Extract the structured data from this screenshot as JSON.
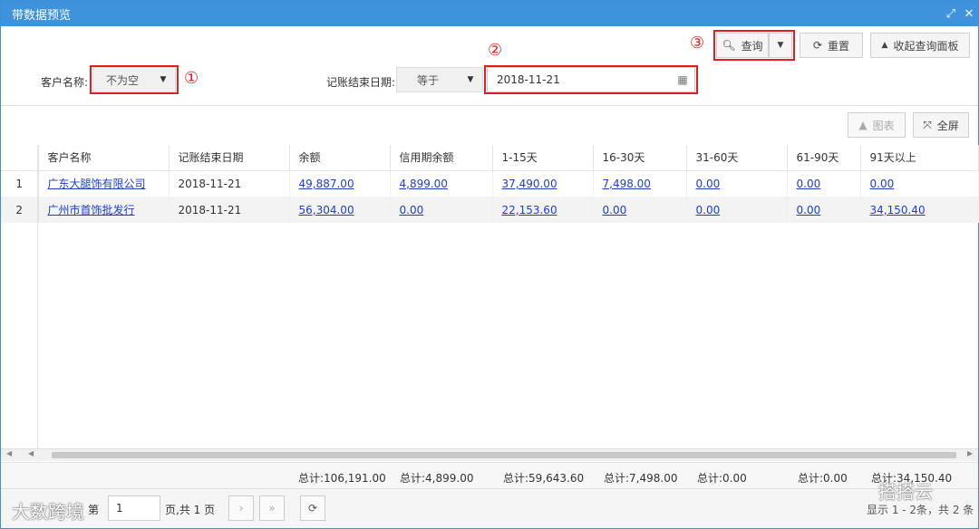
{
  "window": {
    "title": "带数据预览"
  },
  "toolbar": {
    "query_label": "查询",
    "reset_label": "重置",
    "collapse_label": "收起查询面板"
  },
  "filters": {
    "customer_label": "客户名称:",
    "customer_op": "不为空",
    "date_label": "记账结束日期:",
    "date_op": "等于",
    "date_value": "2018-11-21"
  },
  "annotations": [
    "①",
    "②",
    "③"
  ],
  "grid_toolbar": {
    "chart_label": "图表",
    "fullscreen_label": "全屏"
  },
  "table": {
    "columns": [
      "客户名称",
      "记账结束日期",
      "余额",
      "信用期余额",
      "1-15天",
      "16-30天",
      "31-60天",
      "61-90天",
      "91天以上"
    ],
    "rows": [
      {
        "num": "1",
        "customer": "广东大腿饰有限公司",
        "date": "2018-11-21",
        "balance": "49,887.00",
        "credit": "4,899.00",
        "d1_15": "37,490.00",
        "d16_30": "7,498.00",
        "d31_60": "0.00",
        "d61_90": "0.00",
        "d91": "0.00"
      },
      {
        "num": "2",
        "customer": "广州市首饰批发行",
        "date": "2018-11-21",
        "balance": "56,304.00",
        "credit": "0.00",
        "d1_15": "22,153.60",
        "d16_30": "0.00",
        "d31_60": "0.00",
        "d61_90": "0.00",
        "d91": "34,150.40"
      }
    ],
    "totals": {
      "balance": "总计:106,191.00",
      "credit": "总计:4,899.00",
      "d1_15": "总计:59,643.60",
      "d16_30": "总计:7,498.00",
      "d31_60": "总计:0.00",
      "d61_90": "总计:0.00",
      "d91": "总计:34,150.40"
    }
  },
  "pager": {
    "page_prefix": "第",
    "page_value": "1",
    "page_suffix": "页,共 1 页",
    "display": "显示 1 - 2条，共 2 条"
  },
  "watermarks": {
    "left": "大数跨境",
    "right": "搭搭云"
  },
  "colors": {
    "title_bar": "#3f93dc",
    "highlight": "#e02020",
    "link": "#1a3fcf"
  }
}
